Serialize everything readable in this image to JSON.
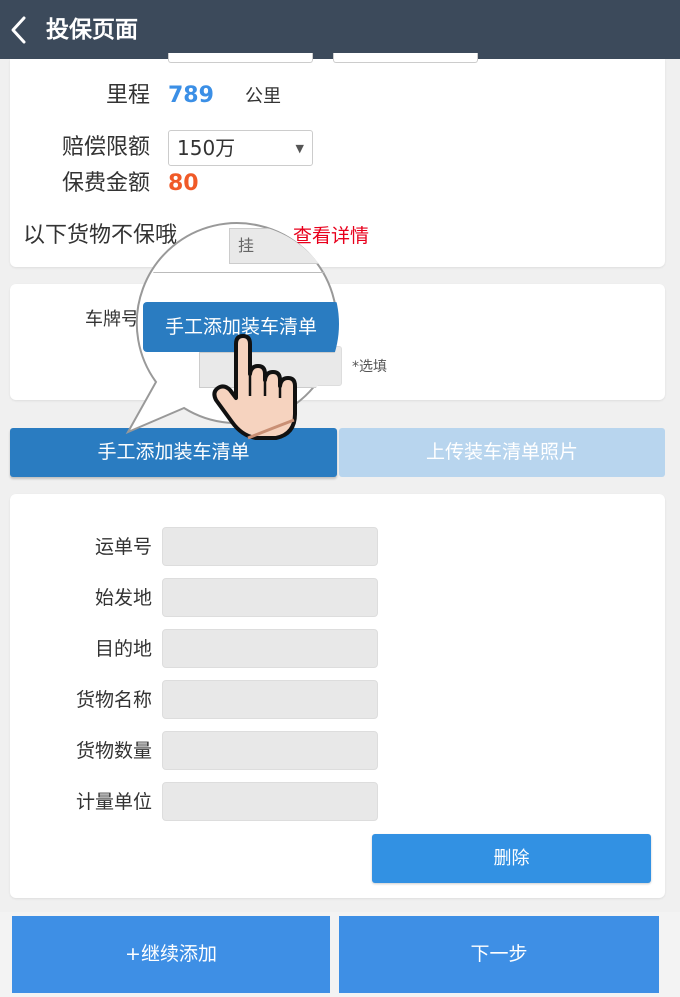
{
  "header": {
    "title": "投保页面"
  },
  "insurance": {
    "mileage_label": "里程",
    "mileage_value": "789",
    "mileage_unit": "公里",
    "limit_label": "赔偿限额",
    "limit_value": "150万",
    "premium_label": "保费金额",
    "premium_value": "80",
    "exclusion_text": "以下货物不保哦",
    "details_link": "查看详情"
  },
  "plate": {
    "label": "车牌号",
    "optional_hint": "*选填"
  },
  "tabs": {
    "manual_label": "手工添加装车清单",
    "upload_label": "上传装车清单照片"
  },
  "callout": {
    "button_label": "手工添加装车清单",
    "field_text": "挂"
  },
  "cargo_form": {
    "fields": [
      {
        "label": "运单号",
        "value": ""
      },
      {
        "label": "始发地",
        "value": ""
      },
      {
        "label": "目的地",
        "value": ""
      },
      {
        "label": "货物名称",
        "value": ""
      },
      {
        "label": "货物数量",
        "value": ""
      },
      {
        "label": "计量单位",
        "value": ""
      }
    ],
    "delete_label": "删除"
  },
  "footer": {
    "add_more_label": "+继续添加",
    "next_label": "下一步"
  },
  "colors": {
    "header_bg": "#3c4a5b",
    "primary": "#3b8fe6",
    "active_tab": "#2a7cc1",
    "inactive_tab": "#b8d5ee",
    "premium": "#f05a28",
    "link": "#e8001c"
  }
}
